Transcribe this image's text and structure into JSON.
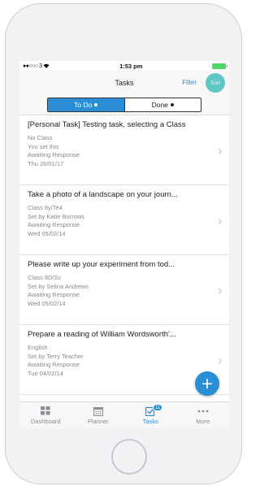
{
  "status_bar": {
    "carrier": "●●○○○ 3",
    "time": "1:53 pm"
  },
  "nav": {
    "title": "Tasks",
    "filter_label": "Filter",
    "sort_label": "Sort"
  },
  "segments": {
    "todo_label": "To Do",
    "done_label": "Done",
    "active": "todo"
  },
  "tasks": [
    {
      "title": "[Personal Task] Testing task, selecting a Class",
      "line1": "No Class",
      "line2": "You set this",
      "line3": "Awaiting Response",
      "line4": "Thu 26/01/17"
    },
    {
      "title": "Take a photo of a landscape on your journ...",
      "line1": "Class 8y/Te4",
      "line2": "Set by Katie Burrows",
      "line3": "Awaiting Response",
      "line4": "Wed 05/02/14"
    },
    {
      "title": "Please write up your experiment from tod...",
      "line1": "Class 8D/Sc",
      "line2": "Set by Selina Andrews",
      "line3": "Awaiting Response",
      "line4": "Wed 05/02/14"
    },
    {
      "title": "Prepare a reading of William Wordsworth'...",
      "line1": "English",
      "line2": "Set by Terry Teacher",
      "line3": "Awaiting Response",
      "line4": "Tue 04/02/14"
    }
  ],
  "fab_label": "+",
  "tab_bar": {
    "items": [
      {
        "label": "Dashboard",
        "icon": "dashboard-icon"
      },
      {
        "label": "Planner",
        "icon": "calendar-icon"
      },
      {
        "label": "Tasks",
        "icon": "tasks-icon",
        "badge": "11"
      },
      {
        "label": "More",
        "icon": "more-icon"
      }
    ],
    "active": "Tasks"
  },
  "colors": {
    "accent": "#2a8ed6",
    "sort_button": "#5fc7c6",
    "battery": "#4cd964"
  }
}
